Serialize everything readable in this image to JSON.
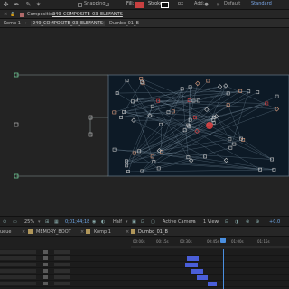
{
  "toolbar": {
    "snapping_label": "Snapping",
    "fill_label": "Fill:",
    "stroke_label": "Stroke:",
    "px_label": "px",
    "add_label": "Add:",
    "workspace_default": "Default",
    "workspace_standard": "Standard",
    "fill_color": "#c84040",
    "stroke_color": "#ffffff"
  },
  "panel": {
    "title_prefix": "Composition",
    "title_name": "249_COMPOSITE_03_ELEFANTS",
    "breadcrumbs": [
      "Komp 1",
      "249_COMPOSITE_03_ELEFANTS",
      "Dumbo_01_B"
    ]
  },
  "viewer_controls": {
    "zoom": "25%",
    "timecode": "0;01;44;18",
    "resolution": "Half",
    "camera": "Active Camera",
    "views": "1 View",
    "offset": "+0.0"
  },
  "timeline": {
    "tabs": [
      "ueue",
      "MEMORY_BOOT",
      "Komp 1",
      "Dumbo_01_B"
    ],
    "ruler_ticks": [
      "00:00s",
      "00:15s",
      "00:30s",
      "00:45s",
      "01:00s",
      "01:15s"
    ],
    "accent_color": "#4a5ed8",
    "playhead_color": "#4a8fe0"
  },
  "colors": {
    "comp_bg": "#0d1a26",
    "point_outline": "#c8c8c8",
    "accent_point": "#e04040"
  }
}
